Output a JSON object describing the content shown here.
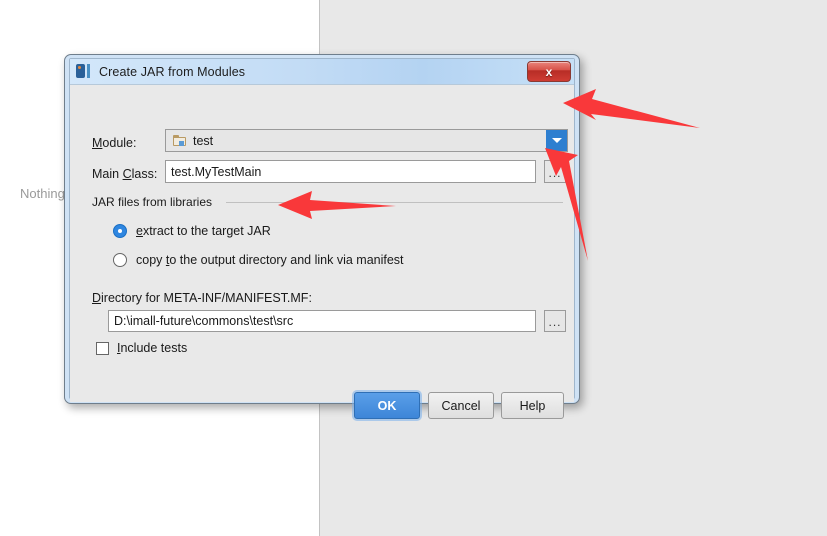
{
  "backdrop": {
    "nothing_text": "Nothing"
  },
  "dialog": {
    "title": "Create JAR from Modules",
    "title_icon": "intellij-idea-icon",
    "close_icon": "close-icon",
    "module": {
      "label_pre": "M",
      "label_post": "odule:",
      "value": "test",
      "icon": "folder-icon",
      "dropdown_icon": "chevron-down-icon"
    },
    "main_class": {
      "label_pre": "Main ",
      "label_mn": "C",
      "label_post": "lass:",
      "value": "test.MyTestMain",
      "browse_label": "..."
    },
    "group": {
      "title": "JAR files from libraries",
      "options": [
        {
          "pre": "",
          "mn": "e",
          "post": "xtract to the target JAR",
          "selected": true
        },
        {
          "pre": "copy ",
          "mn": "t",
          "post": "o the output directory and link via manifest",
          "selected": false
        }
      ]
    },
    "directory": {
      "label_mn": "D",
      "label_post": "irectory for META-INF/MANIFEST.MF:",
      "value": "D:\\imall-future\\commons\\test\\src",
      "browse_label": "..."
    },
    "include_tests": {
      "mn": "I",
      "post": "nclude tests",
      "checked": false
    },
    "buttons": {
      "ok": "OK",
      "cancel": "Cancel",
      "help": "Help"
    }
  },
  "colors": {
    "accent_blue": "#2e7fd0",
    "ok_blue": "#3d86d8",
    "annotation_red": "#f9383a",
    "close_red": "#cf3c33",
    "dialog_bg": "#e9e9e9",
    "titlebar_blue": "#c3dcf5"
  },
  "annotations": {
    "arrow_module_dropdown": "red-arrow-pointing-left",
    "arrow_main_class_browse": "red-arrow-pointing-up-left",
    "arrow_extract_radio": "red-arrow-pointing-left"
  }
}
